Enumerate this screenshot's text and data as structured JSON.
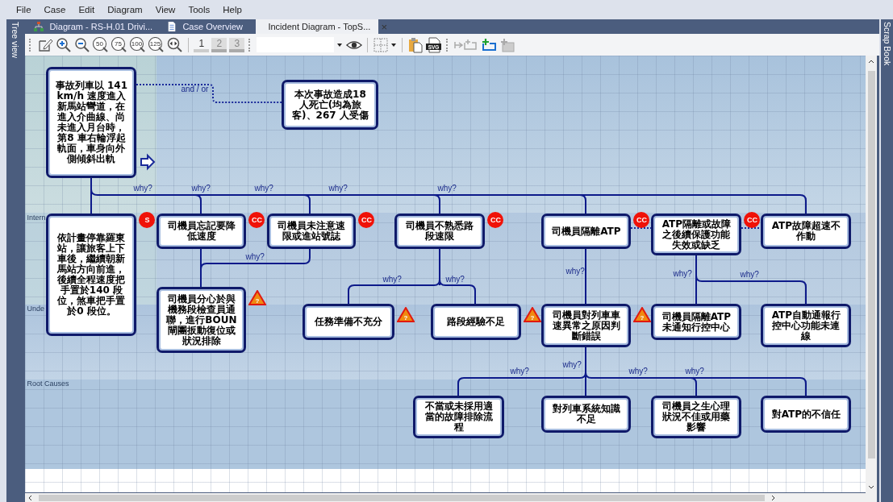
{
  "menu": [
    "File",
    "Case",
    "Edit",
    "Diagram",
    "View",
    "Tools",
    "Help"
  ],
  "side_panels": {
    "left": "Tree view",
    "right": "Scrap Book"
  },
  "tabs": [
    {
      "label": "Diagram - RS-H.01 Drivi...",
      "selected": false
    },
    {
      "label": "Case Overview",
      "selected": false
    },
    {
      "label": "Incident Diagram - TopS...",
      "selected": true,
      "close": "×"
    }
  ],
  "toolbar": {
    "zoom_presets": [
      "50",
      "75",
      "100",
      "125"
    ],
    "layers": [
      {
        "label": "1",
        "selected": true
      },
      {
        "label": "2",
        "selected": false
      },
      {
        "label": "3",
        "selected": false
      }
    ],
    "export_label": "SVG"
  },
  "diagram": {
    "lanes": [
      {
        "label": "Intern"
      },
      {
        "label": "Unde"
      },
      {
        "label": "Root Causes"
      }
    ],
    "nodes": [
      {
        "text": "事故列車以 141km/h 速度進入新馬站彎道，在進入介曲線、尚未進入月台時，第8 車右輪浮起軌面，車身向外側傾斜出軌"
      },
      {
        "text": "本次事故造成18 人死亡(均為旅客)、267 人受傷"
      },
      {
        "text": "依計畫停靠羅東站，讓旅客上下車後，繼續朝新馬站方向前進，後續全程速度把手置於140 段位，煞車把手置於0 段位。",
        "badge": {
          "kind": "circle",
          "text": "S"
        }
      },
      {
        "text": "司機員忘記要降低速度",
        "badge": {
          "kind": "circle",
          "text": "CC"
        }
      },
      {
        "text": "司機員未注意速限或進站號誌",
        "badge": {
          "kind": "circle",
          "text": "CC"
        }
      },
      {
        "text": "司機員不熟悉路段速限",
        "badge": {
          "kind": "circle",
          "text": "CC"
        }
      },
      {
        "text": "司機員隔離ATP",
        "badge": {
          "kind": "circle",
          "text": "CC"
        }
      },
      {
        "text": "ATP隔離或故障之後續保護功能失效或缺乏",
        "badge": {
          "kind": "circle",
          "text": "CC"
        }
      },
      {
        "text": "ATP故障超速不作動"
      },
      {
        "text": "司機員分心於與機務段檢查員通聯，進行BOUN閘團扳動復位或狀況排除",
        "badge": {
          "kind": "warning",
          "text": "?"
        }
      },
      {
        "text": "任務準備不充分",
        "badge": {
          "kind": "warning",
          "text": "?"
        }
      },
      {
        "text": "路段經驗不足",
        "badge": {
          "kind": "warning",
          "text": "?"
        }
      },
      {
        "text": "司機員對列車車速異常之原因判斷錯誤",
        "badge": {
          "kind": "warning",
          "text": "?"
        }
      },
      {
        "text": "司機員隔離ATP未通知行控中心"
      },
      {
        "text": "ATP自動通報行控中心功能未連線"
      },
      {
        "text": "不當或未採用適當的故障排除流程"
      },
      {
        "text": "對列車系統知識不足"
      },
      {
        "text": "司機員之生心理狀況不佳或用藥影響"
      },
      {
        "text": "對ATP的不信任"
      }
    ],
    "edge_labels": [
      "and / or",
      "why?",
      "why?",
      "why?",
      "why?",
      "why?",
      "why?",
      "why?",
      "why?",
      "why?",
      "why?",
      "why?",
      "why?",
      "why?",
      "why?",
      "why?"
    ]
  }
}
